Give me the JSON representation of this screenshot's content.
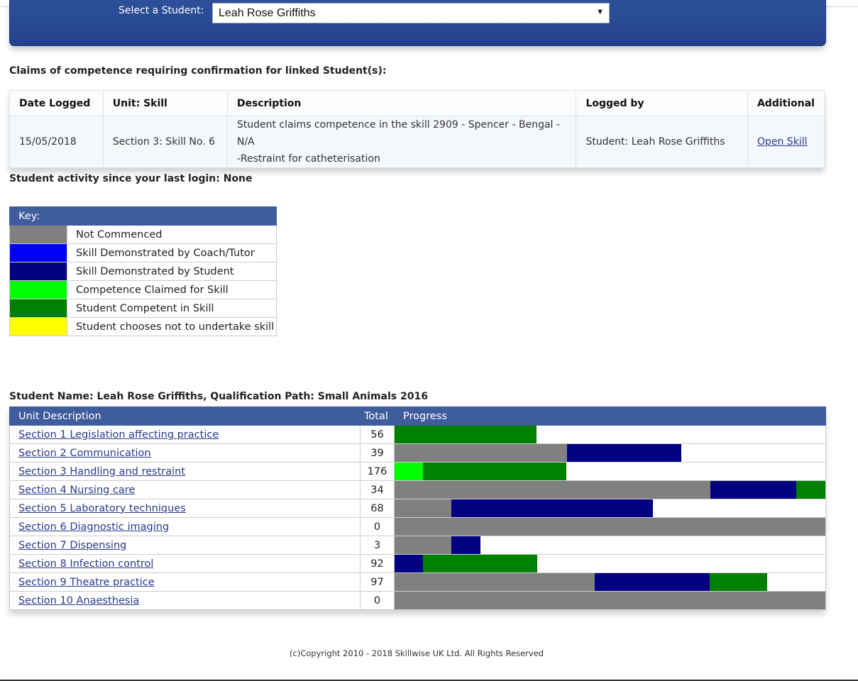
{
  "header": {
    "select_label": "Select a Student:",
    "selected_student": "Leah Rose Griffiths",
    "dropdown_arrow": "▼"
  },
  "claims": {
    "title": "Claims of competence requiring confirmation for linked Student(s):",
    "columns": [
      "Date Logged",
      "Unit: Skill",
      "Description",
      "Logged by",
      "Additional"
    ],
    "rows": [
      {
        "date": "15/05/2018",
        "unit_skill": "Section 3: Skill No. 6",
        "description_line1": "Student claims competence in the skill 2909 - Spencer - Bengal - N/A",
        "description_line2": "-Restraint for catheterisation",
        "logged_by": "Student: Leah Rose Griffiths",
        "action": "Open Skill"
      }
    ]
  },
  "activity": {
    "text": "Student activity since your last login: None"
  },
  "key": {
    "title": "Key:",
    "items": [
      {
        "color": "#808080",
        "label": "Not Commenced"
      },
      {
        "color": "#0000ff",
        "label": "Skill Demonstrated by Coach/Tutor"
      },
      {
        "color": "#000080",
        "label": "Skill Demonstrated by Student"
      },
      {
        "color": "#00ff00",
        "label": "Competence Claimed for Skill"
      },
      {
        "color": "#008000",
        "label": "Student Competent in Skill"
      },
      {
        "color": "#ffff00",
        "label": "Student chooses not to undertake skill"
      }
    ]
  },
  "progress": {
    "title": "Student Name: Leah Rose Griffiths, Qualification Path: Small Animals 2016",
    "columns": [
      "Unit Description",
      "Total",
      "Progress"
    ],
    "rows": [
      {
        "unit": "Section 1 Legislation affecting practice",
        "total": "56",
        "segments": [
          {
            "color": "#008000",
            "fraction": 0.33
          }
        ]
      },
      {
        "unit": "Section 2 Communication",
        "total": "39",
        "segments": [
          {
            "color": "#808080",
            "fraction": 0.4
          },
          {
            "color": "#000080",
            "fraction": 0.265
          }
        ]
      },
      {
        "unit": "Section 3 Handling and restraint",
        "total": "176",
        "segments": [
          {
            "color": "#00ff00",
            "fraction": 0.066
          },
          {
            "color": "#008000",
            "fraction": 0.333
          }
        ]
      },
      {
        "unit": "Section 4 Nursing care",
        "total": "34",
        "segments": [
          {
            "color": "#808080",
            "fraction": 0.733
          },
          {
            "color": "#000080",
            "fraction": 0.2
          },
          {
            "color": "#008000",
            "fraction": 0.067
          }
        ]
      },
      {
        "unit": "Section 5 Laboratory techniques",
        "total": "68",
        "segments": [
          {
            "color": "#808080",
            "fraction": 0.132
          },
          {
            "color": "#000080",
            "fraction": 0.467
          }
        ]
      },
      {
        "unit": "Section 6 Diagnostic imaging",
        "total": "0",
        "segments": [
          {
            "color": "#808080",
            "fraction": 1.0
          }
        ]
      },
      {
        "unit": "Section 7 Dispensing",
        "total": "3",
        "segments": [
          {
            "color": "#808080",
            "fraction": 0.132
          },
          {
            "color": "#000080",
            "fraction": 0.068
          }
        ]
      },
      {
        "unit": "Section 8 Infection control",
        "total": "92",
        "segments": [
          {
            "color": "#000080",
            "fraction": 0.066
          },
          {
            "color": "#008000",
            "fraction": 0.265
          }
        ]
      },
      {
        "unit": "Section 9 Theatre practice",
        "total": "97",
        "segments": [
          {
            "color": "#808080",
            "fraction": 0.465
          },
          {
            "color": "#000080",
            "fraction": 0.267
          },
          {
            "color": "#008000",
            "fraction": 0.133
          }
        ]
      },
      {
        "unit": "Section 10 Anaesthesia",
        "total": "0",
        "segments": [
          {
            "color": "#808080",
            "fraction": 1.0
          }
        ]
      }
    ]
  },
  "footer": {
    "copyright": "(c)Copyright 2010 - 2018 Skillwise UK Ltd. All Rights Reserved"
  }
}
